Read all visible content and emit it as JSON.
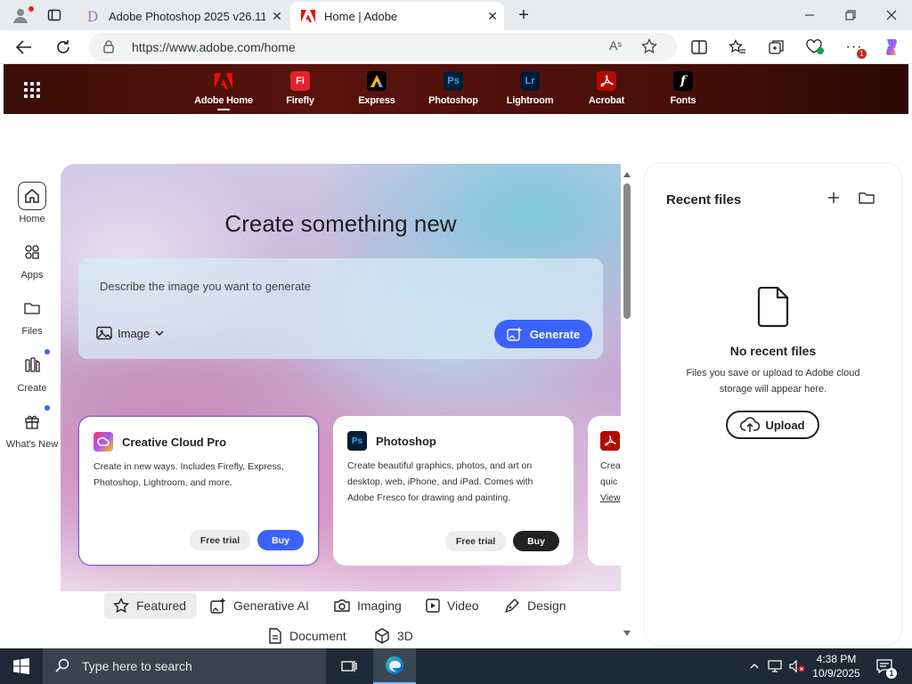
{
  "browser": {
    "tabs": [
      {
        "title": "Adobe Photoshop 2025 v26.11.0...",
        "active": false
      },
      {
        "title": "Home | Adobe",
        "active": true
      }
    ],
    "url": "https://www.adobe.com/home",
    "read_aloud_glyph": "Aˢ"
  },
  "adobe_nav": {
    "apps": [
      {
        "label": "Adobe Home",
        "logo": "A",
        "color": "#eb1000",
        "active": true
      },
      {
        "label": "Firefly",
        "logo": "Fi",
        "color": "#e4212b",
        "active": false
      },
      {
        "label": "Express",
        "logo": "A",
        "color": "#000000",
        "active": false
      },
      {
        "label": "Photoshop",
        "logo": "Ps",
        "color": "#001e36",
        "active": false
      },
      {
        "label": "Lightroom",
        "logo": "Lr",
        "color": "#001a33",
        "active": false
      },
      {
        "label": "Acrobat",
        "logo": "A",
        "color": "#b30b00",
        "active": false
      },
      {
        "label": "Fonts",
        "logo": "f",
        "color": "#000000",
        "active": false
      }
    ]
  },
  "rail": [
    {
      "label": "Home",
      "icon": "home-icon",
      "active": true,
      "dot": false
    },
    {
      "label": "Apps",
      "icon": "apps-icon",
      "active": false,
      "dot": false
    },
    {
      "label": "Files",
      "icon": "folder-icon",
      "active": false,
      "dot": false
    },
    {
      "label": "Create",
      "icon": "create-icon",
      "active": false,
      "dot": true
    },
    {
      "label": "What's New",
      "icon": "gift-icon",
      "active": false,
      "dot": true
    }
  ],
  "hero": {
    "title": "Create something new",
    "prompt_placeholder": "Describe the image you want to generate",
    "mode_label": "Image",
    "generate_label": "Generate"
  },
  "cards": [
    {
      "title": "Creative Cloud Pro",
      "desc": "Create in new ways. Includes Firefly, Express, Photoshop, Lightroom, and more.",
      "trial": "Free trial",
      "buy": "Buy",
      "buy_color": "#3b63fb"
    },
    {
      "title": "Photoshop",
      "logo": "Ps",
      "desc": "Create beautiful graphics, photos, and art on desktop, web, iPhone, and iPad. Comes with Adobe Fresco for drawing and painting.",
      "trial": "Free trial",
      "buy": "Buy",
      "buy_color": "#222222"
    },
    {
      "partial_lines": [
        "Crea",
        "quic",
        "View"
      ]
    }
  ],
  "categories": [
    {
      "label": "Featured",
      "icon": "star-icon",
      "selected": true
    },
    {
      "label": "Generative AI",
      "icon": "generative-ai-icon",
      "selected": false
    },
    {
      "label": "Imaging",
      "icon": "camera-icon",
      "selected": false
    },
    {
      "label": "Video",
      "icon": "video-icon",
      "selected": false
    },
    {
      "label": "Design",
      "icon": "pen-icon",
      "selected": false
    },
    {
      "label": "Document",
      "icon": "document-icon",
      "selected": false
    },
    {
      "label": "3D",
      "icon": "cube-icon",
      "selected": false
    }
  ],
  "recent": {
    "title": "Recent files",
    "empty_title": "No recent files",
    "empty_sub": "Files you save or upload to Adobe cloud storage will appear here.",
    "upload_label": "Upload"
  },
  "taskbar": {
    "search_placeholder": "Type here to search",
    "time": "4:38 PM",
    "date": "10/9/2025",
    "notification_count": "1"
  }
}
